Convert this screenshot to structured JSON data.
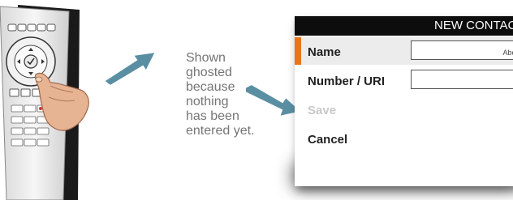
{
  "caption": {
    "lines": [
      "Shown",
      "ghosted",
      "because",
      "nothing",
      "has been",
      "entered yet."
    ]
  },
  "dialog": {
    "title": "NEW CONTACT",
    "rows": [
      {
        "label": "Name",
        "has_field": true,
        "field_hint": "Abc",
        "state": "active"
      },
      {
        "label": "Number / URI",
        "has_field": true,
        "field_hint": "",
        "state": "normal"
      },
      {
        "label": "Save",
        "has_field": false,
        "state": "disabled"
      },
      {
        "label": "Cancel",
        "has_field": false,
        "state": "normal"
      }
    ]
  },
  "colors": {
    "accent": "#e8751a",
    "arrow": "#5a8fa3",
    "header_bg": "#0d0d0d",
    "ghost_text": "#c8c8c8",
    "caption_text": "#757575"
  }
}
